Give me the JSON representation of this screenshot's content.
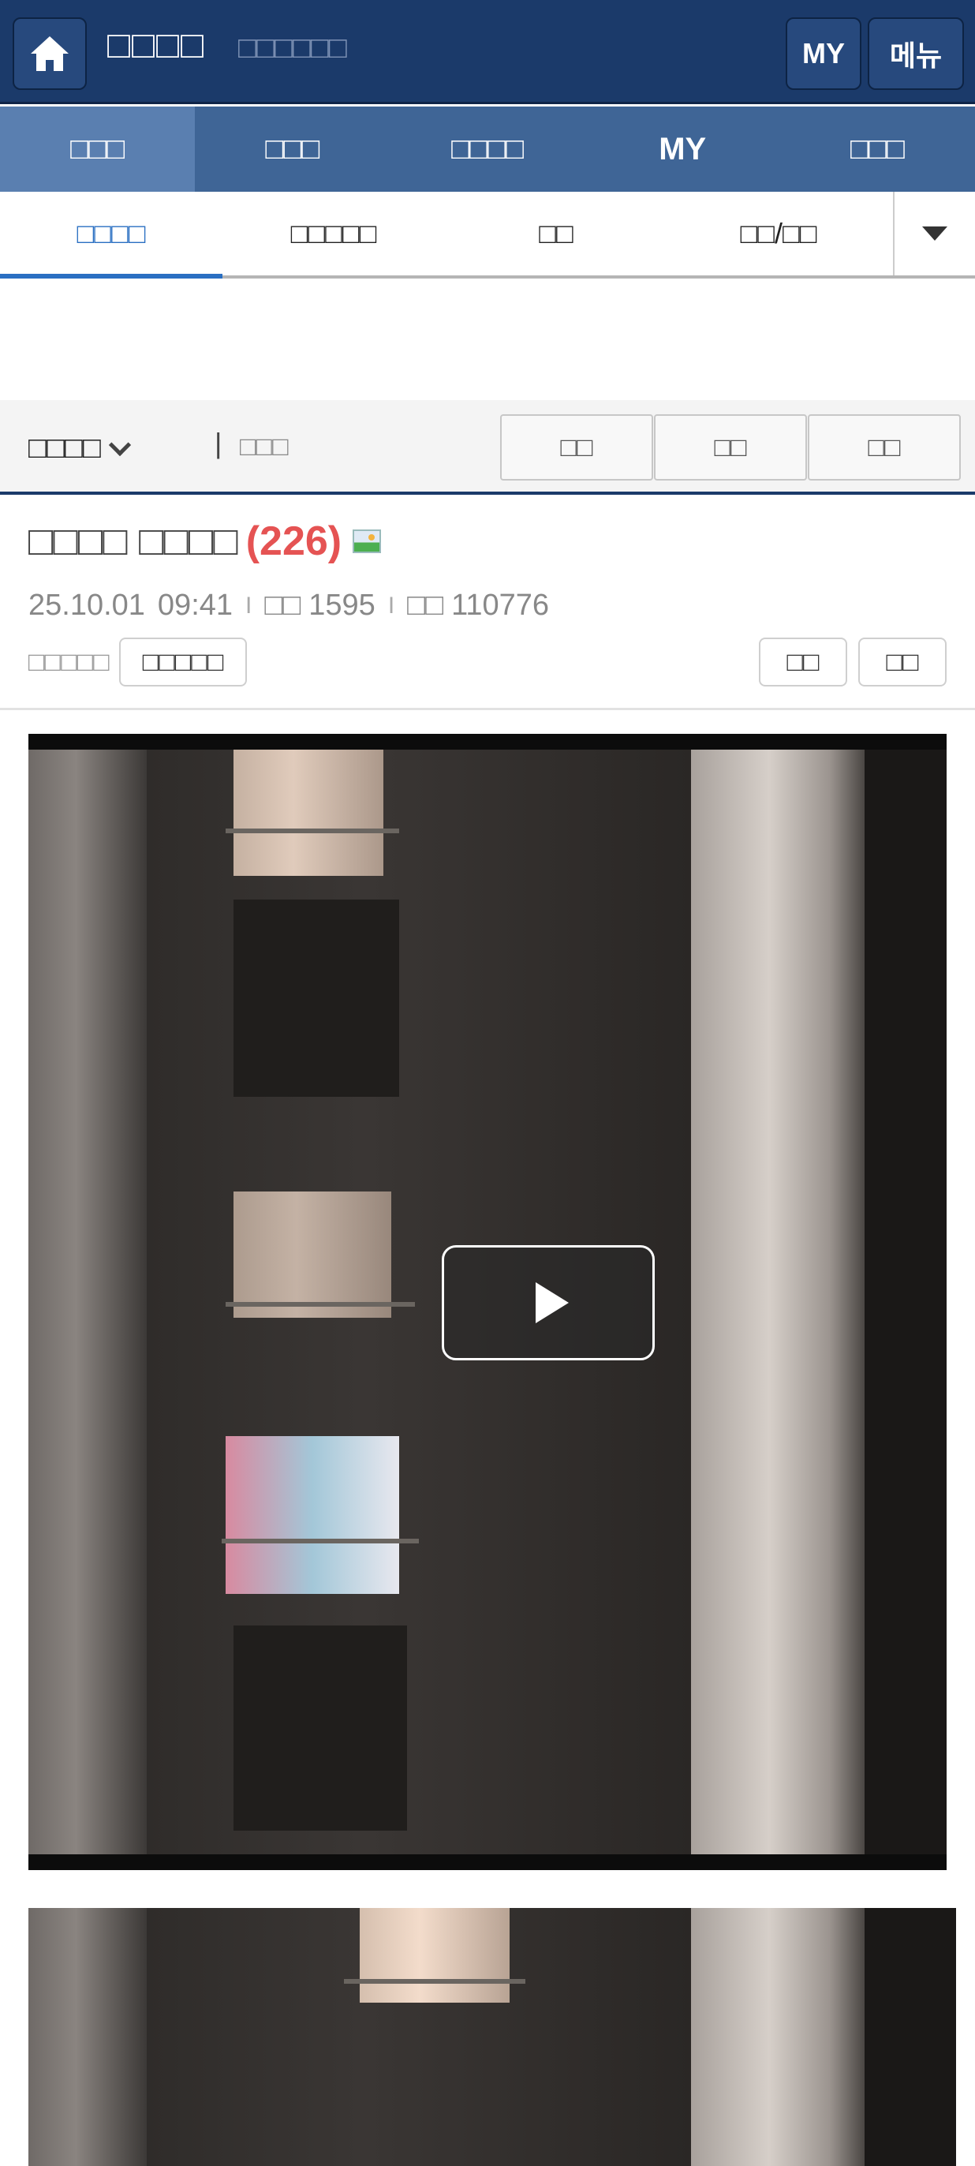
{
  "header": {
    "site_title": "□□□□",
    "site_subtitle": "□□□□□□",
    "my_label": "MY",
    "menu_label": "메뉴"
  },
  "main_nav": [
    {
      "label": "□□□",
      "active": true
    },
    {
      "label": "□□□",
      "active": false
    },
    {
      "label": "□□□□",
      "active": false
    },
    {
      "label": "MY",
      "active": false
    },
    {
      "label": "□□□",
      "active": false
    }
  ],
  "sub_nav": [
    {
      "label": "□□□□",
      "active": true
    },
    {
      "label": "□□□□□",
      "active": false
    },
    {
      "label": "□□",
      "active": false
    },
    {
      "label": "□□/□□",
      "active": false
    }
  ],
  "board": {
    "name": "□□□□",
    "label": "□□□",
    "buttons": [
      "□□",
      "□□",
      "□□"
    ]
  },
  "post": {
    "title": "□□□□ □□□□",
    "comment_count": "(226)",
    "date": "25.10.01",
    "time": "09:41",
    "recommend_label": "□□",
    "recommend_count": "1595",
    "views_label": "□□",
    "views_count": "110776",
    "author": "□□□□□",
    "author_button": "□□□□□",
    "action_buttons": [
      "□□",
      "□□"
    ]
  },
  "icons": {
    "home": "home-icon",
    "dropdown": "caret-down-icon",
    "board_chevron": "chevron-down-icon",
    "image_attached": "image-icon",
    "play": "play-icon"
  },
  "colors": {
    "header_bg": "#1b3a6a",
    "nav_bg": "#3f6596",
    "active_tab": "#2a6fc2",
    "comment_count": "#e55353"
  }
}
